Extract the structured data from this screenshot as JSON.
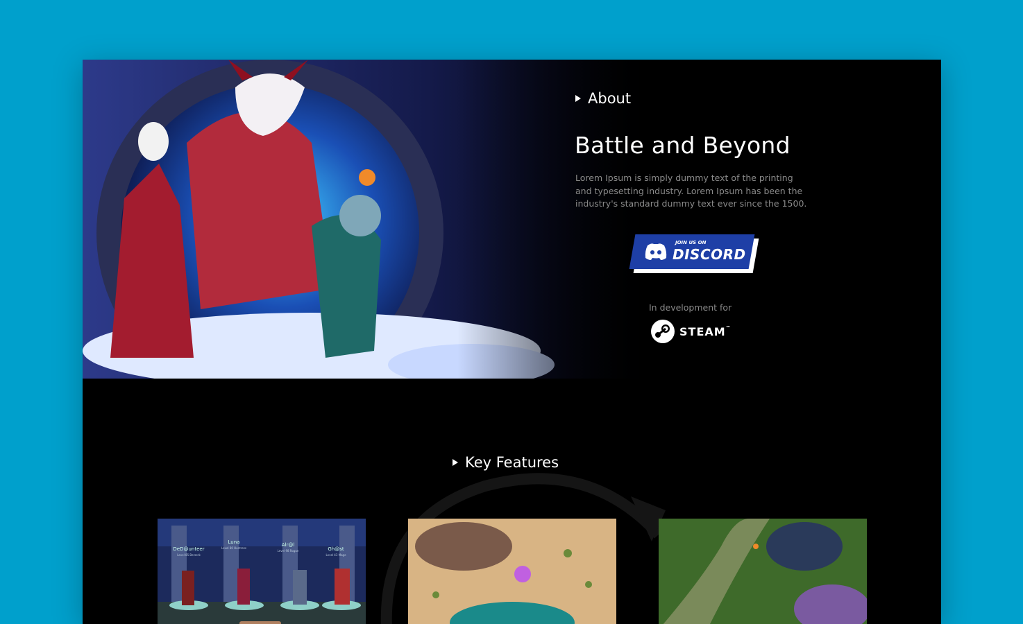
{
  "about": {
    "section_label": "About",
    "title": "Battle and Beyond",
    "description": "Lorem Ipsum is simply dummy text of the printing and typesetting industry. Lorem Ipsum has been the industry's standard dummy text ever since the 1500.",
    "discord": {
      "small_text": "JOIN US ON",
      "big_text": "DISCORD"
    },
    "in_development_label": "In development for",
    "platform": "STEAM",
    "platform_mark": "™"
  },
  "features": {
    "section_label": "Key Features",
    "screenshots": [
      {
        "name": "character-select",
        "characters": [
          {
            "name": "DeD@unteer",
            "level": "Level 85 Berserk"
          },
          {
            "name": "Luna",
            "level": "Level 80 Huntress"
          },
          {
            "name": "Alr@l",
            "level": "Level 98 Rogue"
          },
          {
            "name": "Gh@st",
            "level": "Level 43 Mage"
          }
        ]
      },
      {
        "name": "desert-battle"
      },
      {
        "name": "forest-battle"
      }
    ]
  },
  "colors": {
    "page_background": "#00a0cc",
    "frame_background": "#000000",
    "discord_blue": "#1e3fa6",
    "muted_text": "#8a8a8a"
  },
  "icons": [
    "play-triangle-icon",
    "discord-logo-icon",
    "steam-logo-icon"
  ]
}
